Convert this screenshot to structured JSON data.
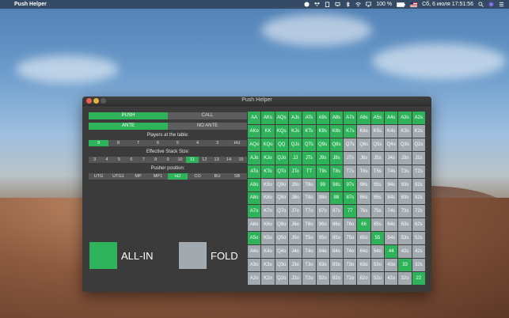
{
  "menubar": {
    "apple": "",
    "app_name": "Push Helper",
    "battery": "100 %",
    "datetime": "Сб, 6 июля  17:51:56"
  },
  "window": {
    "title": "Push Helper"
  },
  "controls": {
    "mode": [
      "PUSH",
      "CALL"
    ],
    "mode_selected": 0,
    "ante": [
      "ANTE",
      "NO ANTE"
    ],
    "ante_selected": 0,
    "players_label": "Players at the table:",
    "players": [
      "9",
      "8",
      "7",
      "6",
      "5",
      "4",
      "3",
      "HU"
    ],
    "players_selected": 0,
    "stack_label": "Effective Stack Size:",
    "stacks": [
      "3",
      "4",
      "5",
      "6",
      "7",
      "8",
      "9",
      "10",
      "11",
      "12",
      "13",
      "14",
      "15"
    ],
    "stack_selected": 8,
    "position_label": "Pusher position:",
    "positions": [
      "UTG",
      "UTG1",
      "MP",
      "MP1",
      "HJ",
      "CO",
      "BU",
      "SB"
    ],
    "position_selected": 4
  },
  "legend": {
    "allin": "ALL-IN",
    "fold": "FOLD",
    "allin_color": "#2fb35a",
    "fold_color": "#a3aaaf"
  },
  "hand_grid": [
    [
      [
        "AA",
        1
      ],
      [
        "AKs",
        1
      ],
      [
        "AQs",
        1
      ],
      [
        "AJs",
        1
      ],
      [
        "ATs",
        1
      ],
      [
        "A9s",
        1
      ],
      [
        "A8s",
        1
      ],
      [
        "A7s",
        1
      ],
      [
        "A6s",
        1
      ],
      [
        "A5s",
        1
      ],
      [
        "A4s",
        1
      ],
      [
        "A3s",
        1
      ],
      [
        "A2s",
        1
      ]
    ],
    [
      [
        "AKo",
        1
      ],
      [
        "KK",
        1
      ],
      [
        "KQs",
        1
      ],
      [
        "KJs",
        1
      ],
      [
        "KTs",
        1
      ],
      [
        "K9s",
        1
      ],
      [
        "K8s",
        1
      ],
      [
        "K7s",
        1
      ],
      [
        "K6s",
        0
      ],
      [
        "K5s",
        0
      ],
      [
        "K4s",
        0
      ],
      [
        "K3s",
        0
      ],
      [
        "K2s",
        0
      ]
    ],
    [
      [
        "AQo",
        1
      ],
      [
        "KQo",
        1
      ],
      [
        "QQ",
        1
      ],
      [
        "QJs",
        1
      ],
      [
        "QTs",
        1
      ],
      [
        "Q9s",
        1
      ],
      [
        "Q8s",
        1
      ],
      [
        "Q7s",
        0
      ],
      [
        "Q6s",
        0
      ],
      [
        "Q5s",
        0
      ],
      [
        "Q4s",
        0
      ],
      [
        "Q3s",
        0
      ],
      [
        "Q2s",
        0
      ]
    ],
    [
      [
        "AJo",
        1
      ],
      [
        "KJo",
        1
      ],
      [
        "QJo",
        1
      ],
      [
        "JJ",
        1
      ],
      [
        "JTs",
        1
      ],
      [
        "J9s",
        1
      ],
      [
        "J8s",
        1
      ],
      [
        "J7s",
        0
      ],
      [
        "J6s",
        0
      ],
      [
        "J5s",
        0
      ],
      [
        "J4s",
        0
      ],
      [
        "J3s",
        0
      ],
      [
        "J2s",
        0
      ]
    ],
    [
      [
        "ATo",
        1
      ],
      [
        "KTo",
        1
      ],
      [
        "QTo",
        1
      ],
      [
        "JTo",
        1
      ],
      [
        "TT",
        1
      ],
      [
        "T9s",
        1
      ],
      [
        "T8s",
        1
      ],
      [
        "T7s",
        0
      ],
      [
        "T6s",
        0
      ],
      [
        "T5s",
        0
      ],
      [
        "T4s",
        0
      ],
      [
        "T3s",
        0
      ],
      [
        "T2s",
        0
      ]
    ],
    [
      [
        "A9o",
        1
      ],
      [
        "K9o",
        0
      ],
      [
        "Q9o",
        0
      ],
      [
        "J9o",
        0
      ],
      [
        "T9o",
        0
      ],
      [
        "99",
        1
      ],
      [
        "98s",
        1
      ],
      [
        "97s",
        1
      ],
      [
        "96s",
        0
      ],
      [
        "95s",
        0
      ],
      [
        "94s",
        0
      ],
      [
        "93s",
        0
      ],
      [
        "92s",
        0
      ]
    ],
    [
      [
        "A8o",
        1
      ],
      [
        "K8o",
        0
      ],
      [
        "Q8o",
        0
      ],
      [
        "J8o",
        0
      ],
      [
        "T8o",
        0
      ],
      [
        "98o",
        0
      ],
      [
        "88",
        1
      ],
      [
        "87s",
        1
      ],
      [
        "86s",
        0
      ],
      [
        "85s",
        0
      ],
      [
        "84s",
        0
      ],
      [
        "83s",
        0
      ],
      [
        "82s",
        0
      ]
    ],
    [
      [
        "A7o",
        1
      ],
      [
        "K7o",
        0
      ],
      [
        "Q7o",
        0
      ],
      [
        "J7o",
        0
      ],
      [
        "T7o",
        0
      ],
      [
        "97o",
        0
      ],
      [
        "87o",
        0
      ],
      [
        "77",
        1
      ],
      [
        "76s",
        0
      ],
      [
        "75s",
        0
      ],
      [
        "74s",
        0
      ],
      [
        "73s",
        0
      ],
      [
        "72s",
        0
      ]
    ],
    [
      [
        "A6o",
        0
      ],
      [
        "K6o",
        0
      ],
      [
        "Q6o",
        0
      ],
      [
        "J6o",
        0
      ],
      [
        "T6o",
        0
      ],
      [
        "96o",
        0
      ],
      [
        "86o",
        0
      ],
      [
        "76o",
        0
      ],
      [
        "66",
        1
      ],
      [
        "65s",
        0
      ],
      [
        "64s",
        0
      ],
      [
        "63s",
        0
      ],
      [
        "62s",
        0
      ]
    ],
    [
      [
        "A5o",
        1
      ],
      [
        "K5o",
        0
      ],
      [
        "Q5o",
        0
      ],
      [
        "J5o",
        0
      ],
      [
        "T5o",
        0
      ],
      [
        "95o",
        0
      ],
      [
        "85o",
        0
      ],
      [
        "75o",
        0
      ],
      [
        "65o",
        0
      ],
      [
        "55",
        1
      ],
      [
        "54s",
        0
      ],
      [
        "53s",
        0
      ],
      [
        "52s",
        0
      ]
    ],
    [
      [
        "A4o",
        0
      ],
      [
        "K4o",
        0
      ],
      [
        "Q4o",
        0
      ],
      [
        "J4o",
        0
      ],
      [
        "T4o",
        0
      ],
      [
        "94o",
        0
      ],
      [
        "84o",
        0
      ],
      [
        "74o",
        0
      ],
      [
        "64o",
        0
      ],
      [
        "54o",
        0
      ],
      [
        "44",
        1
      ],
      [
        "43s",
        0
      ],
      [
        "42s",
        0
      ]
    ],
    [
      [
        "A3o",
        0
      ],
      [
        "K3o",
        0
      ],
      [
        "Q3o",
        0
      ],
      [
        "J3o",
        0
      ],
      [
        "T3o",
        0
      ],
      [
        "93o",
        0
      ],
      [
        "83o",
        0
      ],
      [
        "73o",
        0
      ],
      [
        "63o",
        0
      ],
      [
        "53o",
        0
      ],
      [
        "43o",
        0
      ],
      [
        "33",
        1
      ],
      [
        "32s",
        0
      ]
    ],
    [
      [
        "A2o",
        0
      ],
      [
        "K2o",
        0
      ],
      [
        "Q2o",
        0
      ],
      [
        "J2o",
        0
      ],
      [
        "T2o",
        0
      ],
      [
        "92o",
        0
      ],
      [
        "82o",
        0
      ],
      [
        "72o",
        0
      ],
      [
        "62o",
        0
      ],
      [
        "52o",
        0
      ],
      [
        "42o",
        0
      ],
      [
        "32o",
        0
      ],
      [
        "22",
        1
      ]
    ]
  ]
}
